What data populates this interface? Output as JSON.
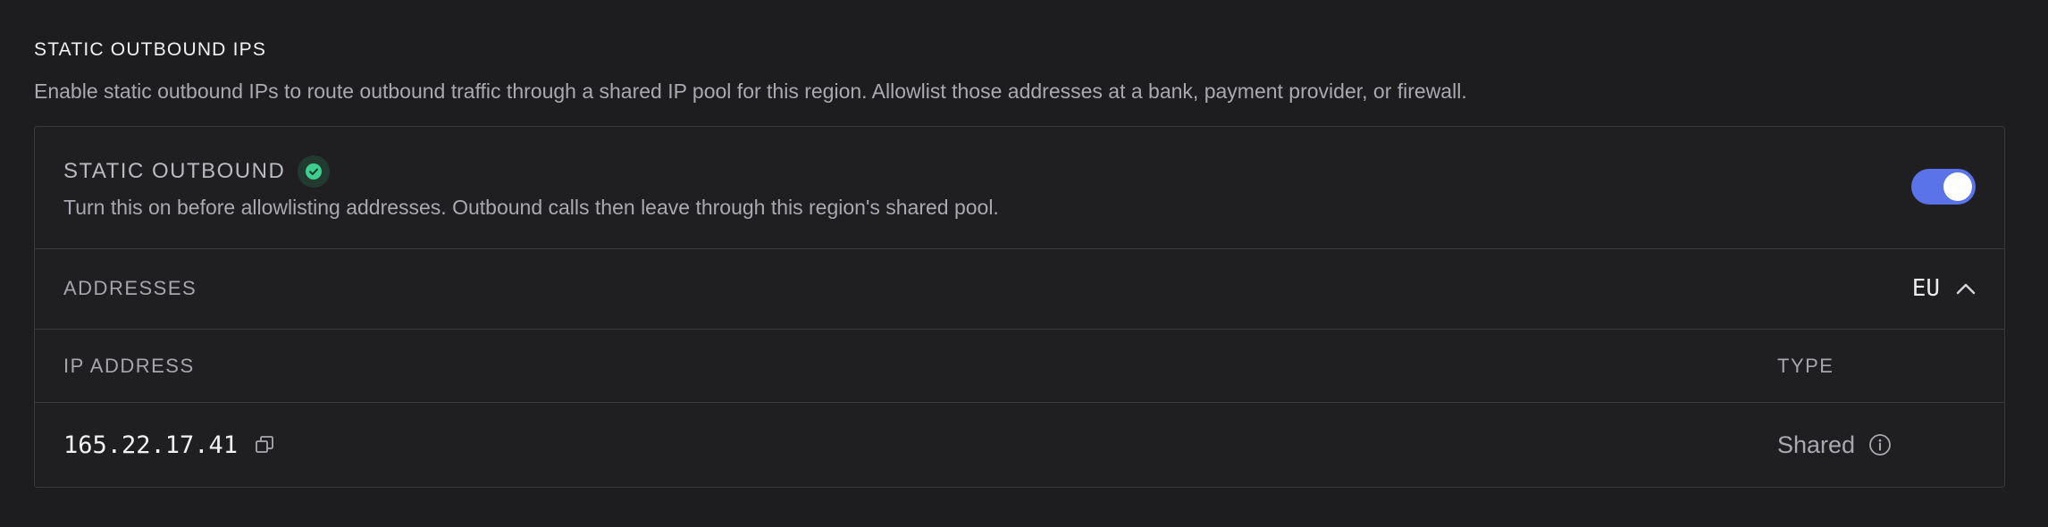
{
  "section": {
    "title": "STATIC OUTBOUND IPS",
    "description": "Enable static outbound IPs to route outbound traffic through a shared IP pool for this region. Allowlist those addresses at a bank, payment provider, or firewall."
  },
  "static_outbound": {
    "title": "STATIC OUTBOUND",
    "status_icon": "check-circle-icon",
    "description": "Turn this on before allowlisting addresses. Outbound calls then leave through this region's shared pool.",
    "enabled": true
  },
  "addresses": {
    "label": "ADDRESSES",
    "region": "EU",
    "expanded": true
  },
  "table": {
    "columns": [
      "IP ADDRESS",
      "TYPE"
    ],
    "rows": [
      {
        "ip": "165.22.17.41",
        "type": "Shared"
      }
    ]
  },
  "colors": {
    "accent": "#5a73e8",
    "success": "#3ecf8e",
    "background": "#1d1d20"
  }
}
